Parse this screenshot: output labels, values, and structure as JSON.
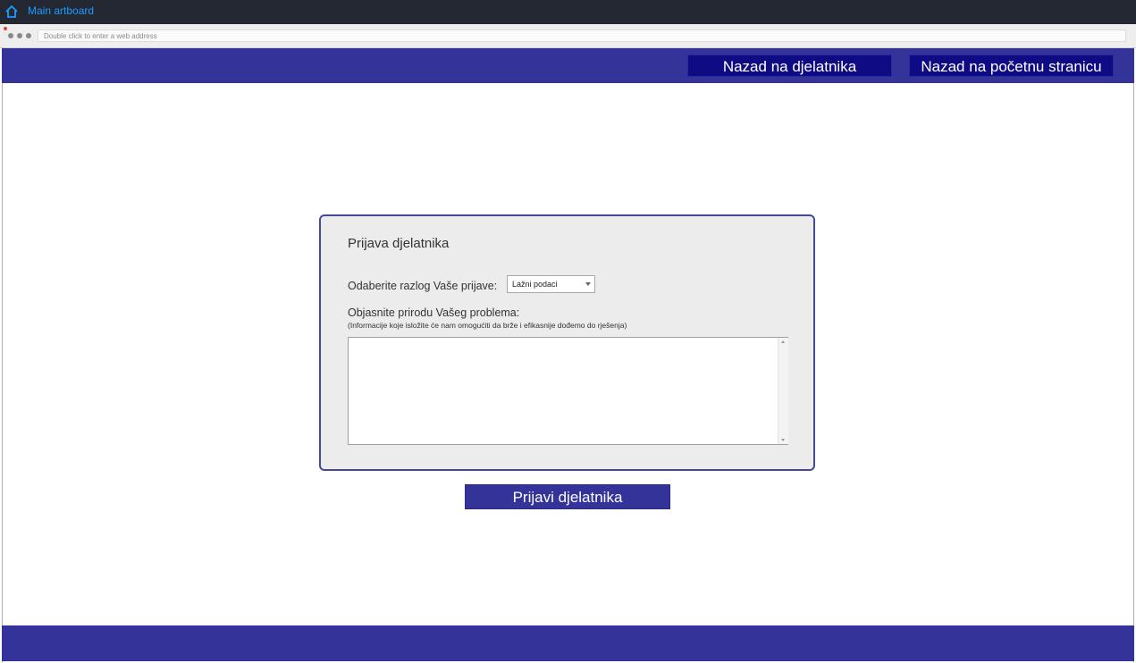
{
  "app": {
    "title": "Main artboard",
    "home_icon": "home-icon"
  },
  "browser": {
    "address_placeholder": "Double click to enter a web address"
  },
  "header": {
    "buttons": [
      {
        "label": "Nazad na djelatnika"
      },
      {
        "label": "Nazad na početnu stranicu"
      }
    ]
  },
  "form": {
    "title": "Prijava djelatnika",
    "reason_label": "Odaberite razlog Vaše prijave:",
    "reason_selected": "Lažni podaci",
    "explain_label": "Objasnite prirodu Vašeg problema:",
    "explain_hint": "(Informacije koje isložite će nam omogućiti da brže i efikasnije dođemo do rješenja)",
    "explain_value": ""
  },
  "submit": {
    "label": "Prijavi djelatnika"
  },
  "colors": {
    "primary": "#34339a",
    "nav_button": "#0f0b84",
    "title_link": "#1e9bff",
    "topbar": "#232833"
  }
}
